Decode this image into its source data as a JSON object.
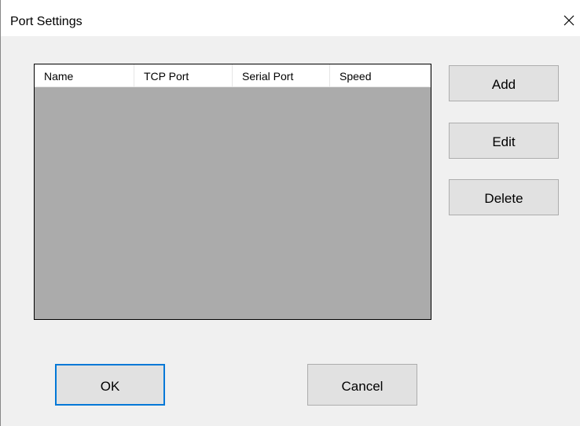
{
  "window": {
    "title": "Port Settings"
  },
  "port_list": {
    "columns": [
      "Name",
      "TCP Port",
      "Serial Port",
      "Speed"
    ],
    "rows": []
  },
  "side_buttons": {
    "add_label": "Add",
    "edit_label": "Edit",
    "delete_label": "Delete"
  },
  "footer_buttons": {
    "ok_label": "OK",
    "cancel_label": "Cancel"
  },
  "colors": {
    "list_background": "#ababab",
    "focus_border": "#0078d7",
    "button_face": "#e1e1e1",
    "dialog_background": "#f0f0f0"
  },
  "icons": {
    "close": "close-icon"
  }
}
